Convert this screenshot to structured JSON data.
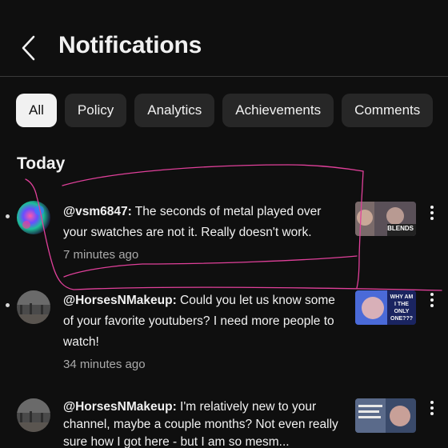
{
  "header": {
    "back_icon": "chevron-left-icon",
    "title": "Notifications"
  },
  "filters": [
    {
      "label": "All",
      "selected": true
    },
    {
      "label": "Policy",
      "selected": false
    },
    {
      "label": "Analytics",
      "selected": false
    },
    {
      "label": "Achievements",
      "selected": false
    },
    {
      "label": "Comments",
      "selected": false
    }
  ],
  "section": {
    "title": "Today"
  },
  "notifications": [
    {
      "username": "@vsm6847:",
      "message": " The seconds of metal played over your swatches are not it. Really doesn't work.",
      "time": "7 minutes ago",
      "unread": true,
      "thumbnail_text": "BLENDS"
    },
    {
      "username": "@HorsesNMakeup:",
      "message": " Could you let us know some of your favorite youtubers?  I need more people to watch!",
      "time": "34 minutes ago",
      "unread": true,
      "thumbnail_text": "WHY AM I THE ONLY ONE???"
    },
    {
      "username": "@HorsesNMakeup:",
      "message": " I'm relatively new to your channel, maybe a couple months?  Not even really sure how I got here - but I am so mesm...",
      "time": "",
      "unread": false,
      "thumbnail_text": ""
    }
  ],
  "colors": {
    "background": "#0f0f0f",
    "chip": "#272727",
    "chip_active": "#f1f1f1",
    "secondary_text": "#aaaaaa",
    "annotation": "#e0409a"
  }
}
